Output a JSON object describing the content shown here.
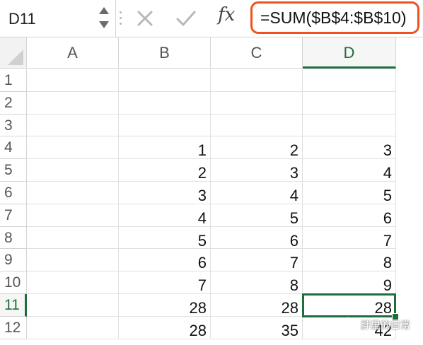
{
  "formula_bar": {
    "name_box": "D11",
    "cancel_icon": "close-icon",
    "enter_icon": "checkmark-icon",
    "fx_label": "fx",
    "formula": "=SUM($B$4:$B$10)",
    "highlight_color": "#f0521f"
  },
  "sheet": {
    "columns": [
      "A",
      "B",
      "C",
      "D"
    ],
    "rows": [
      "1",
      "2",
      "3",
      "4",
      "5",
      "6",
      "7",
      "8",
      "9",
      "10",
      "11",
      "12"
    ],
    "selected_cell": "D11",
    "selection_color": "#1e6e3c",
    "cells": [
      [
        "",
        "",
        "",
        ""
      ],
      [
        "",
        "",
        "",
        ""
      ],
      [
        "",
        "",
        "",
        ""
      ],
      [
        "",
        "1",
        "2",
        "3"
      ],
      [
        "",
        "2",
        "3",
        "4"
      ],
      [
        "",
        "3",
        "4",
        "5"
      ],
      [
        "",
        "4",
        "5",
        "6"
      ],
      [
        "",
        "5",
        "6",
        "7"
      ],
      [
        "",
        "6",
        "7",
        "8"
      ],
      [
        "",
        "7",
        "8",
        "9"
      ],
      [
        "",
        "28",
        "28",
        "28"
      ],
      [
        "",
        "28",
        "35",
        "42"
      ]
    ]
  },
  "watermark": {
    "text": "胖里的日常"
  }
}
